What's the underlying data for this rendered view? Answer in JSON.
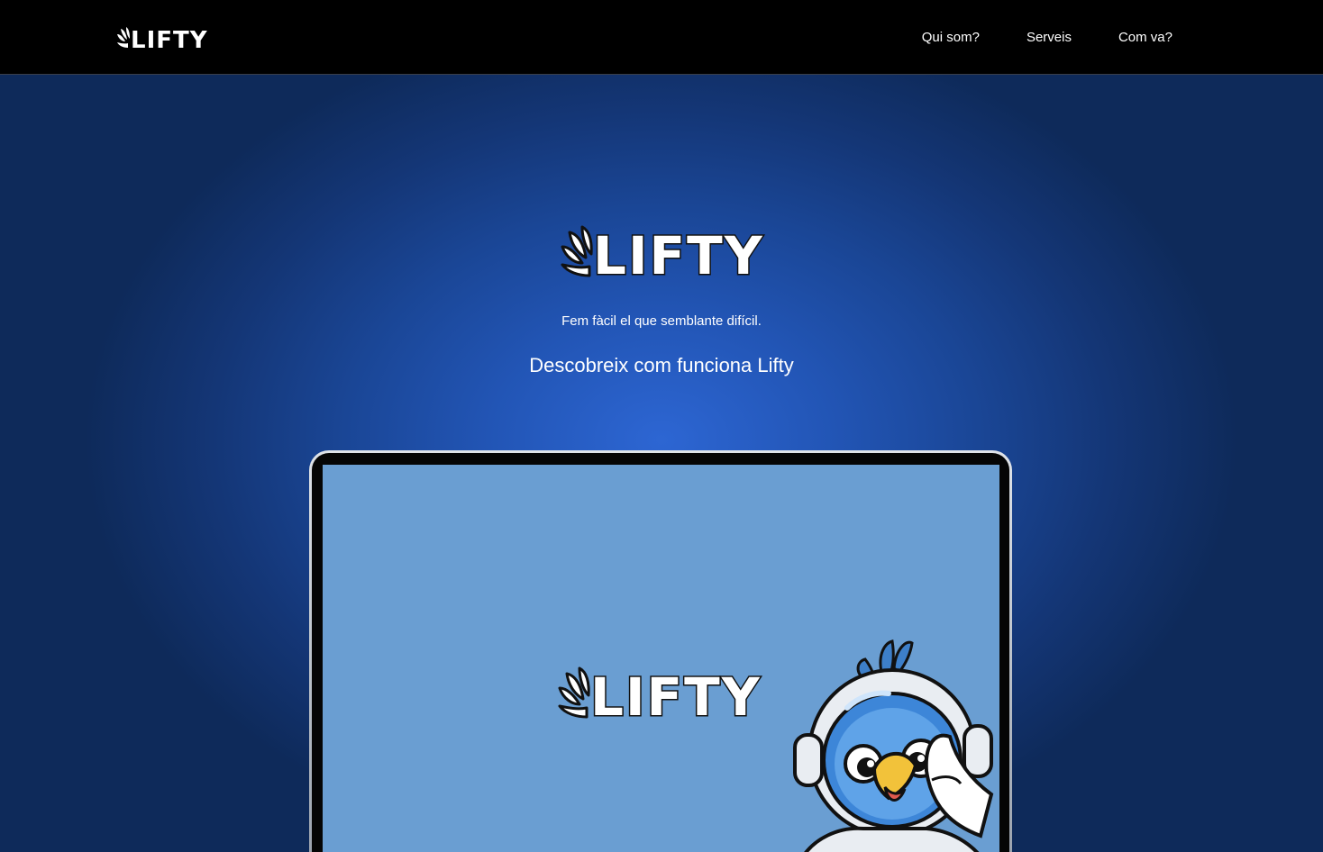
{
  "header": {
    "logo_text": "LIFTY",
    "nav": [
      {
        "label": "Qui som?"
      },
      {
        "label": "Serveis"
      },
      {
        "label": "Com va?"
      }
    ]
  },
  "hero": {
    "logo_text": "LIFTY",
    "tagline": "Fem fàcil el que semblante difícil.",
    "discover_label": "Descobreix com funciona Lifty",
    "laptop_screen": {
      "logo_text": "LIFTY",
      "background_color": "#6a9ed2",
      "mascot": "astronaut-bird-mascot"
    }
  },
  "colors": {
    "topbar": "#000000",
    "hero_center": "#2d66d3",
    "hero_edge": "#0e2a5a",
    "text": "#ffffff"
  }
}
